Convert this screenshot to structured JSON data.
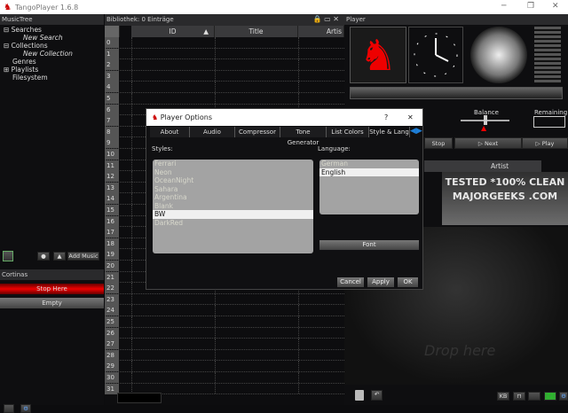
{
  "app": {
    "title": "TangoPlayer 1.6.8"
  },
  "musictree": {
    "title": "MusicTree",
    "items": [
      "Searches",
      "New Search",
      "Collections",
      "New Collection",
      "Genres",
      "Playlists",
      "Filesystem"
    ],
    "add_music": "Add Music"
  },
  "cortinas": {
    "title": "Cortinas",
    "stop_here": "Stop Here",
    "empty": "Empty"
  },
  "library": {
    "title": "Bibliothek:  0  Einträge",
    "columns": [
      "ID",
      "Title",
      "Artis"
    ],
    "rows": [
      "0",
      "1",
      "2",
      "3",
      "4",
      "5",
      "6",
      "7",
      "8",
      "9",
      "10",
      "11",
      "12",
      "13",
      "14",
      "15",
      "16",
      "17",
      "18",
      "19",
      "20",
      "21",
      "22",
      "23",
      "24",
      "25",
      "26",
      "27",
      "28",
      "29",
      "30",
      "31"
    ]
  },
  "player": {
    "title": "Player",
    "balance": "Balance",
    "remaining": "Remaining",
    "stop": "Stop",
    "next": "Next",
    "play": "Play",
    "artist_col": "Artist",
    "drop_here": "Drop here",
    "kb": "KB"
  },
  "watermark": "TESTED *100% CLEAN MAJORGEEKS .COM",
  "dialog": {
    "title": "Player Options",
    "help": "?",
    "close": "✕",
    "tabs": [
      "About",
      "Audio",
      "Compressor",
      "Tone Generator",
      "List Colors",
      "Style & Lang"
    ],
    "styles_label": "Styles:",
    "styles": [
      "Ferrari",
      "Neon",
      "OceanNight",
      "Sahara",
      "Argentina",
      "Blank",
      "BW",
      "DarkRed"
    ],
    "selected_style": "BW",
    "language_label": "Language:",
    "languages": [
      "German",
      "English"
    ],
    "selected_language": "English",
    "font": "Font",
    "cancel": "Cancel",
    "apply": "Apply",
    "ok": "OK"
  },
  "colors": {
    "accent_red": "#d40000",
    "tab_arrow": "#1e7fd8"
  }
}
